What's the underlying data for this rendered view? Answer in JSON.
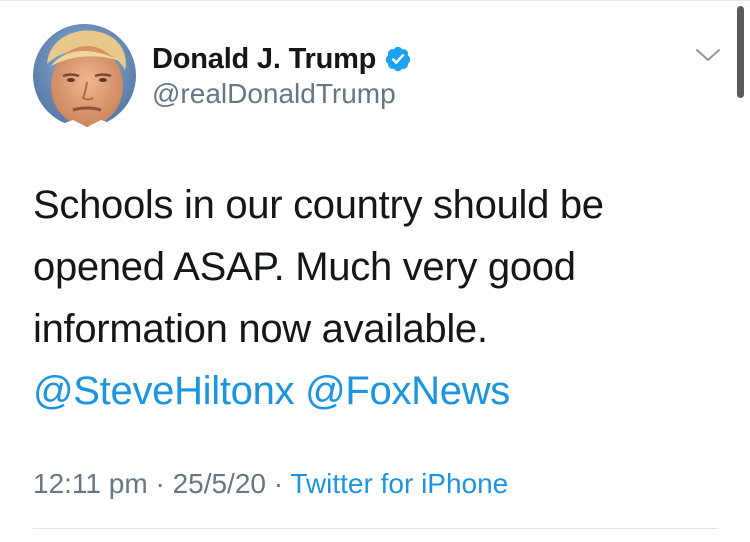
{
  "tweet": {
    "author": {
      "display_name": "Donald J. Trump",
      "handle": "@realDonaldTrump",
      "verified": true,
      "avatar_icon": "profile-photo"
    },
    "body": {
      "line1": "Schools in our country should be",
      "line2": "opened ASAP. Much very good",
      "line3": "information now available.",
      "mention1": "@SteveHiltonx",
      "mention2": "@FoxNews"
    },
    "meta": {
      "time": "12:11 pm",
      "separator1": " · ",
      "date": "25/5/20",
      "separator2": " · ",
      "source": "Twitter for iPhone"
    },
    "menu_icon": "chevron-down-icon"
  },
  "colors": {
    "text": "#14171a",
    "secondary": "#657786",
    "link": "#1b95e0",
    "verified": "#1da1f2",
    "divider": "#e1e8ed"
  }
}
